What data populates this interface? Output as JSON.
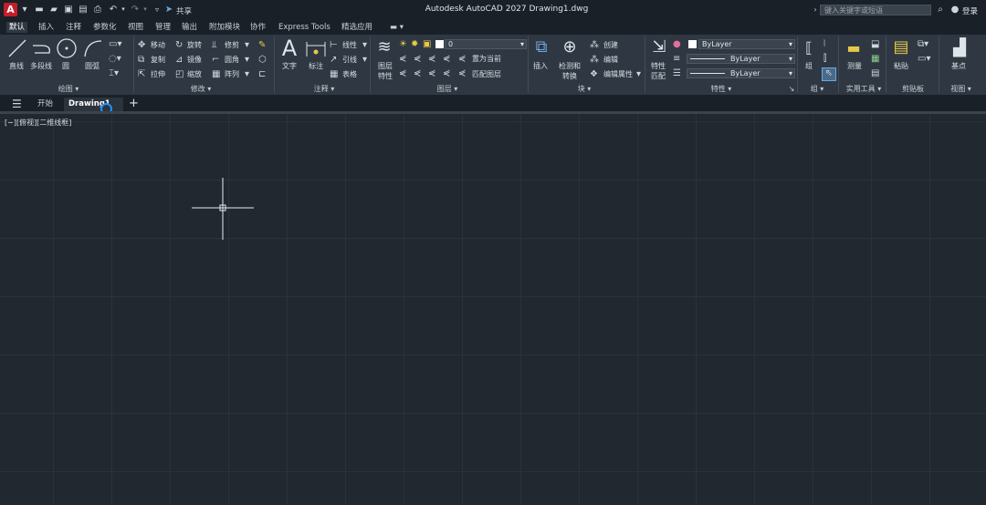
{
  "app": {
    "logo_letter": "A",
    "title": "Autodesk AutoCAD 2027    Drawing1.dwg",
    "share_label": "共享",
    "search_placeholder": "键入关键字或短语",
    "login_label": "登录"
  },
  "menu": [
    "默认",
    "插入",
    "注释",
    "参数化",
    "视图",
    "管理",
    "输出",
    "附加模块",
    "协作",
    "Express Tools",
    "精选应用"
  ],
  "ribbon": {
    "draw": {
      "line": "直线",
      "polyline": "多段线",
      "circle": "圆",
      "arc": "圆弧",
      "panel": "绘图"
    },
    "modify": {
      "move": "移动",
      "rotate": "旋转",
      "trim": "修剪",
      "copy": "复制",
      "mirror": "镜像",
      "fillet": "圆角",
      "stretch": "拉伸",
      "scale": "缩放",
      "array": "阵列",
      "panel": "修改"
    },
    "annotation": {
      "text": "文字",
      "dimension": "标注",
      "linear": "线性",
      "leader": "引线",
      "table": "表格",
      "panel": "注释"
    },
    "layers": {
      "properties_line1": "图层",
      "properties_line2": "特性",
      "layer_value": "0",
      "make_current": "置为当前",
      "match_layer": "匹配图层",
      "panel": "图层"
    },
    "block": {
      "insert": "插入",
      "create": "创建",
      "edit": "编辑",
      "edit_attr": "编辑属性",
      "detect_line1": "检测和",
      "detect_line2": "转换",
      "panel": "块"
    },
    "properties": {
      "match_line1": "特性",
      "match_line2": "匹配",
      "color": "ByLayer",
      "linetype": "ByLayer",
      "lineweight": "ByLayer",
      "panel": "特性"
    },
    "groups": {
      "group": "组",
      "panel": "组"
    },
    "utilities": {
      "measure": "测量",
      "panel": "实用工具"
    },
    "clipboard": {
      "paste": "粘贴",
      "panel": "剪贴板"
    },
    "view": {
      "base": "基点",
      "panel": "视图"
    }
  },
  "filetabs": {
    "start": "开始",
    "drawing": "Drawing1",
    "new": "+"
  },
  "viewport_label": "[−][俯视][二维线框]"
}
